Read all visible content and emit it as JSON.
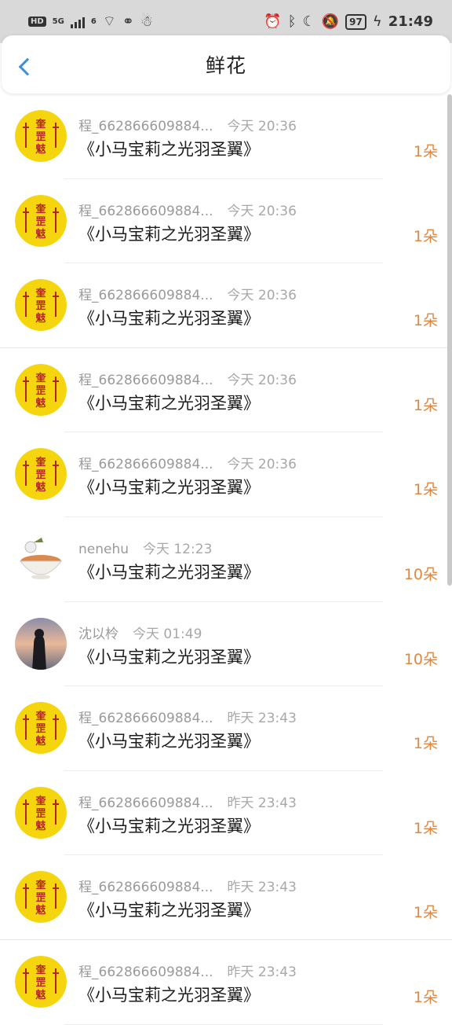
{
  "status_bar": {
    "hd": "HD",
    "net": "5G",
    "wifi_num": "6",
    "battery": "97",
    "time": "21:49"
  },
  "header": {
    "title": "鲜花"
  },
  "items": [
    {
      "user": "程_662866609884...",
      "time": "今天 20:36",
      "work": "《小马宝莉之光羽圣翼》",
      "count": "1朵",
      "avatar": "yellow"
    },
    {
      "user": "程_662866609884...",
      "time": "今天 20:36",
      "work": "《小马宝莉之光羽圣翼》",
      "count": "1朵",
      "avatar": "yellow"
    },
    {
      "user": "程_662866609884...",
      "time": "今天 20:36",
      "work": "《小马宝莉之光羽圣翼》",
      "count": "1朵",
      "avatar": "yellow"
    },
    {
      "user": "程_662866609884...",
      "time": "今天 20:36",
      "work": "《小马宝莉之光羽圣翼》",
      "count": "1朵",
      "avatar": "yellow"
    },
    {
      "user": "程_662866609884...",
      "time": "今天 20:36",
      "work": "《小马宝莉之光羽圣翼》",
      "count": "1朵",
      "avatar": "yellow"
    },
    {
      "user": "nenehu",
      "time": "今天 12:23",
      "work": "《小马宝莉之光羽圣翼》",
      "count": "10朵",
      "avatar": "bowl"
    },
    {
      "user": "沈以柃",
      "time": "今天 01:49",
      "work": "《小马宝莉之光羽圣翼》",
      "count": "10朵",
      "avatar": "sunset"
    },
    {
      "user": "程_662866609884...",
      "time": "昨天 23:43",
      "work": "《小马宝莉之光羽圣翼》",
      "count": "1朵",
      "avatar": "yellow"
    },
    {
      "user": "程_662866609884...",
      "time": "昨天 23:43",
      "work": "《小马宝莉之光羽圣翼》",
      "count": "1朵",
      "avatar": "yellow"
    },
    {
      "user": "程_662866609884...",
      "time": "昨天 23:43",
      "work": "《小马宝莉之光羽圣翼》",
      "count": "1朵",
      "avatar": "yellow"
    },
    {
      "user": "程_662866609884...",
      "time": "昨天 23:43",
      "work": "《小马宝莉之光羽圣翼》",
      "count": "1朵",
      "avatar": "yellow"
    }
  ],
  "colors": {
    "accent": "#3d8fd8",
    "count": "#e08840",
    "muted": "#9a9a9a"
  }
}
